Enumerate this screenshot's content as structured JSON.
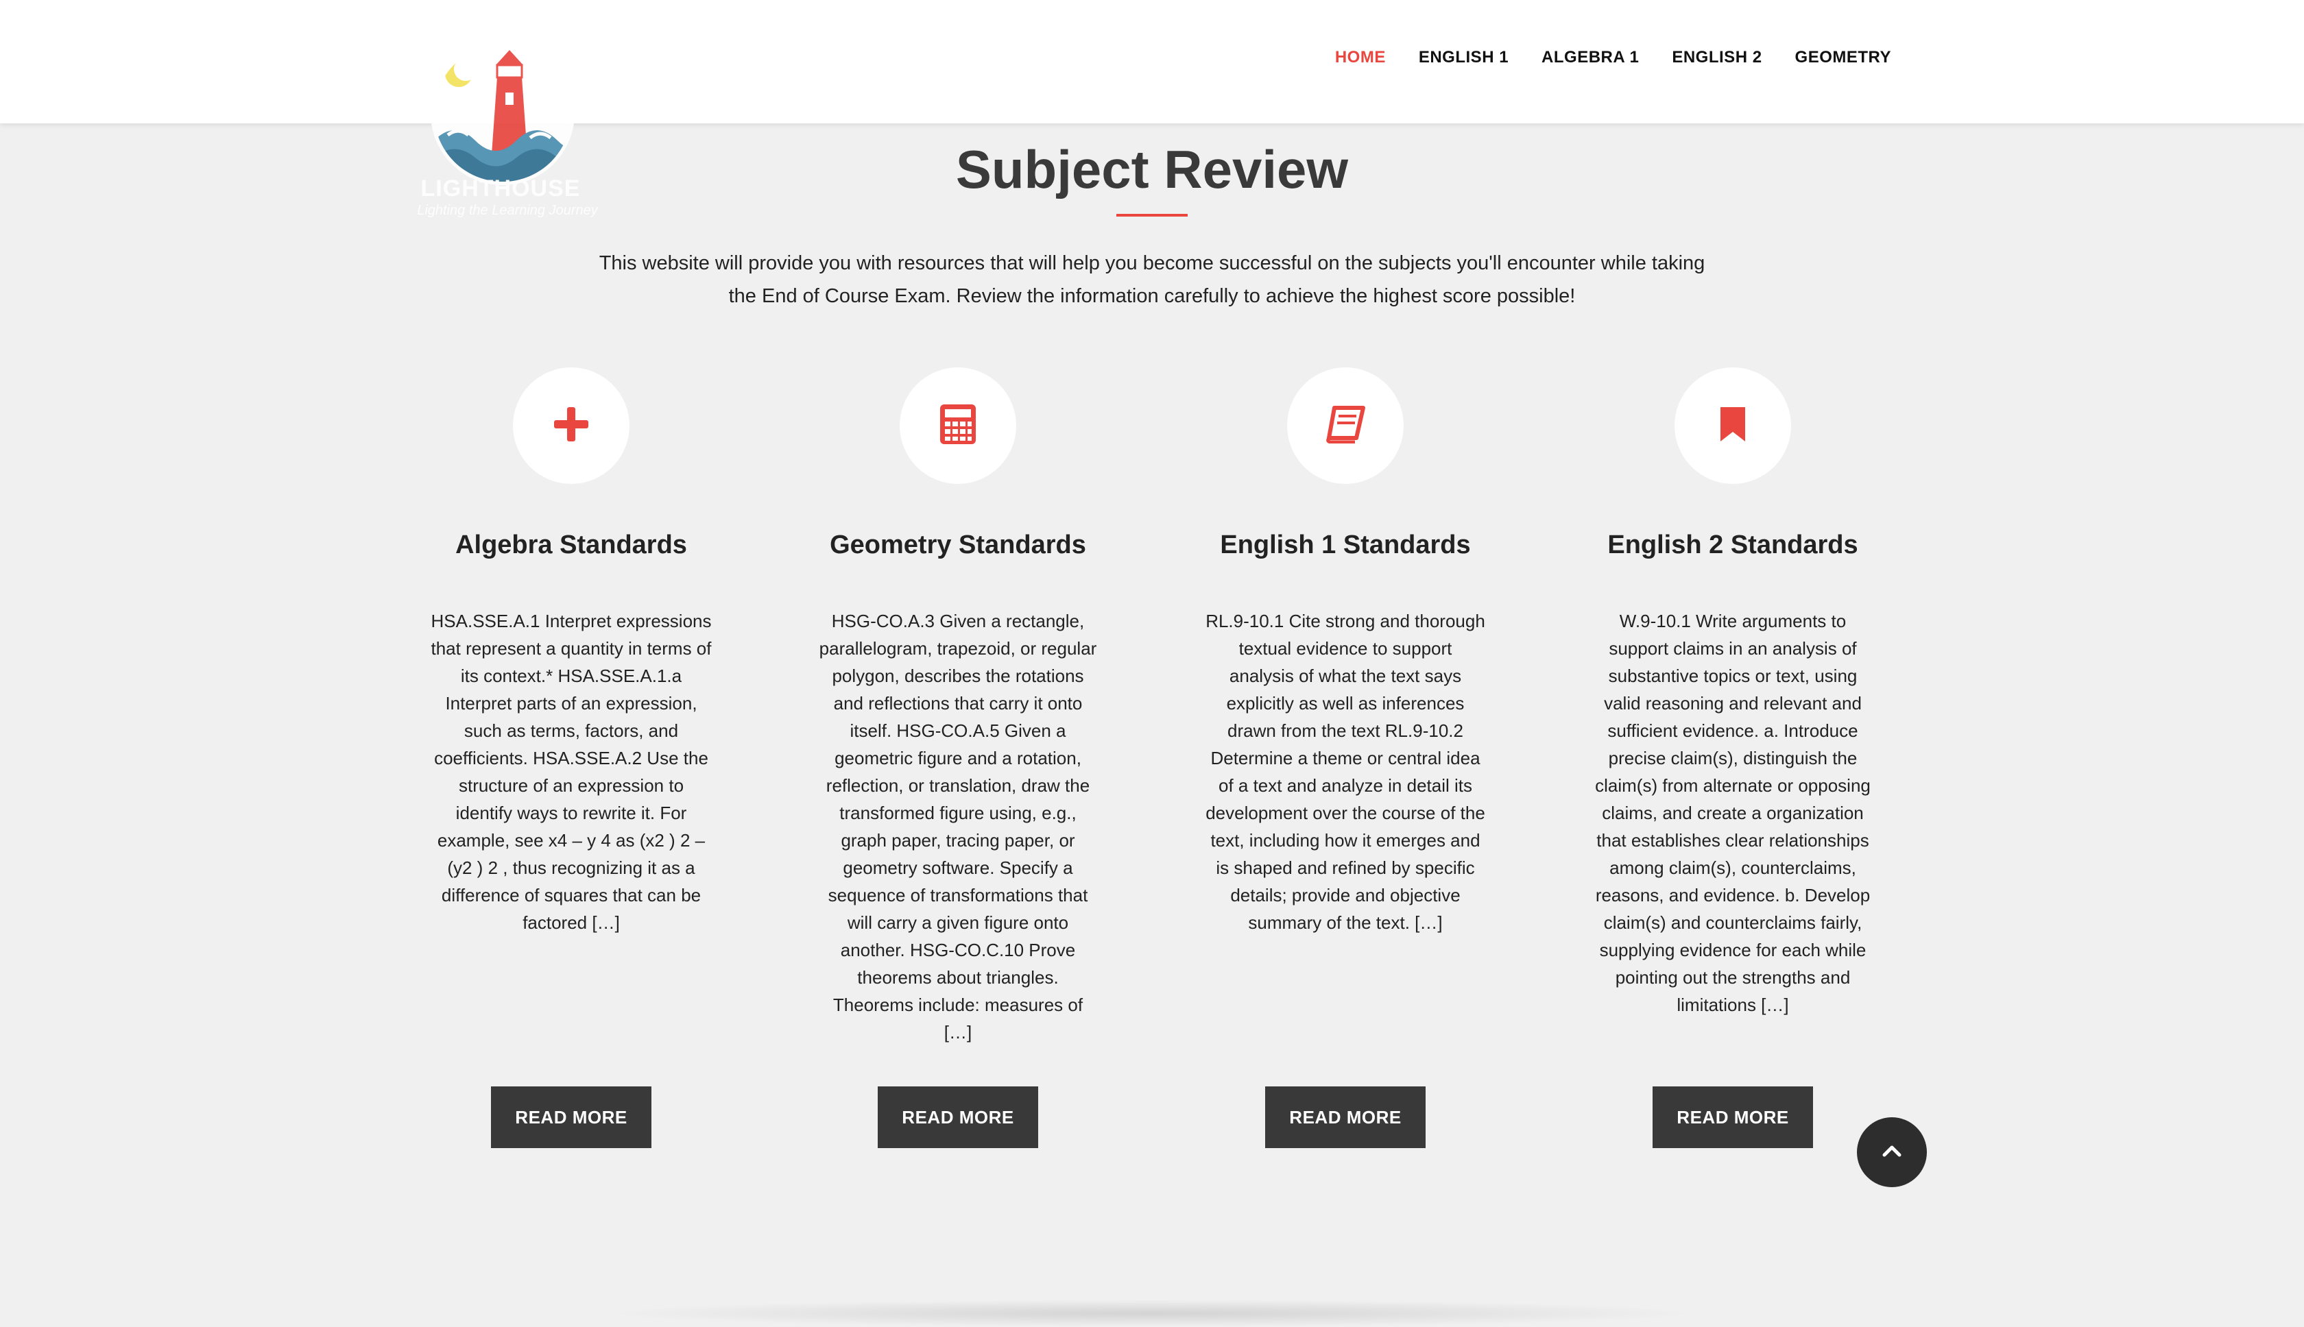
{
  "nav": {
    "items": [
      {
        "label": "HOME",
        "active": true
      },
      {
        "label": "ENGLISH 1",
        "active": false
      },
      {
        "label": "ALGEBRA 1",
        "active": false
      },
      {
        "label": "ENGLISH 2",
        "active": false
      },
      {
        "label": "GEOMETRY",
        "active": false
      }
    ]
  },
  "logo": {
    "name": "LIGHTHOUSE",
    "tagline": "Lighting the Learning Journey"
  },
  "page": {
    "title": "Subject Review",
    "intro": "This website will provide you with resources that will help you become successful on the subjects you'll encounter while taking the End of Course Exam. Review the information carefully to achieve the highest score possible!"
  },
  "cards": [
    {
      "icon": "plus-icon",
      "title": "Algebra Standards",
      "text": "HSA.SSE.A.1 Interpret expressions that represent a quantity in terms of its context.* HSA.SSE.A.1.a Interpret parts of an expression, such as terms, factors, and coefficients. HSA.SSE.A.2 Use the structure of an expression to identify ways to rewrite it. For example, see x4 – y 4 as (x2 ) 2 – (y2 ) 2 , thus recognizing it as a difference of squares that can be factored […]",
      "button": "READ MORE"
    },
    {
      "icon": "calculator-icon",
      "title": "Geometry Standards",
      "text": "HSG-CO.A.3 Given a rectangle, parallelogram, trapezoid, or regular polygon, describes the rotations and reflections that carry it onto itself. HSG-CO.A.5 Given a geometric figure and a rotation, reflection, or translation, draw the transformed figure using, e.g., graph paper, tracing paper, or geometry software. Specify a sequence of transformations that will carry a given figure onto another. HSG-CO.C.10 Prove theorems about triangles. Theorems include: measures of […]",
      "button": "READ MORE"
    },
    {
      "icon": "book-icon",
      "title": "English 1 Standards",
      "text": "RL.9-10.1 Cite strong and thorough textual evidence to support analysis of what the text says explicitly as well as inferences drawn from the text RL.9-10.2 Determine a theme or central idea of a text and analyze in detail its development over the course of the text, including how it emerges and is shaped and refined by specific details; provide and objective summary of the text. […]",
      "button": "READ MORE"
    },
    {
      "icon": "bookmark-icon",
      "title": "English 2 Standards",
      "text": "W.9-10.1 Write arguments to support claims in an analysis of substantive topics or text, using valid reasoning and relevant and sufficient evidence. a. Introduce precise claim(s), distinguish the claim(s) from alternate or opposing claims, and create a organization that establishes clear relationships among claim(s), counterclaims, reasons, and evidence. b. Develop claim(s) and counterclaims fairly, supplying evidence for each while pointing out the strengths and limitations […]",
      "button": "READ MORE"
    }
  ],
  "scroll_top": {
    "icon": "chevron-up-icon"
  },
  "colors": {
    "accent": "#e8463f",
    "button": "#393939",
    "background": "#f0f0f0"
  }
}
